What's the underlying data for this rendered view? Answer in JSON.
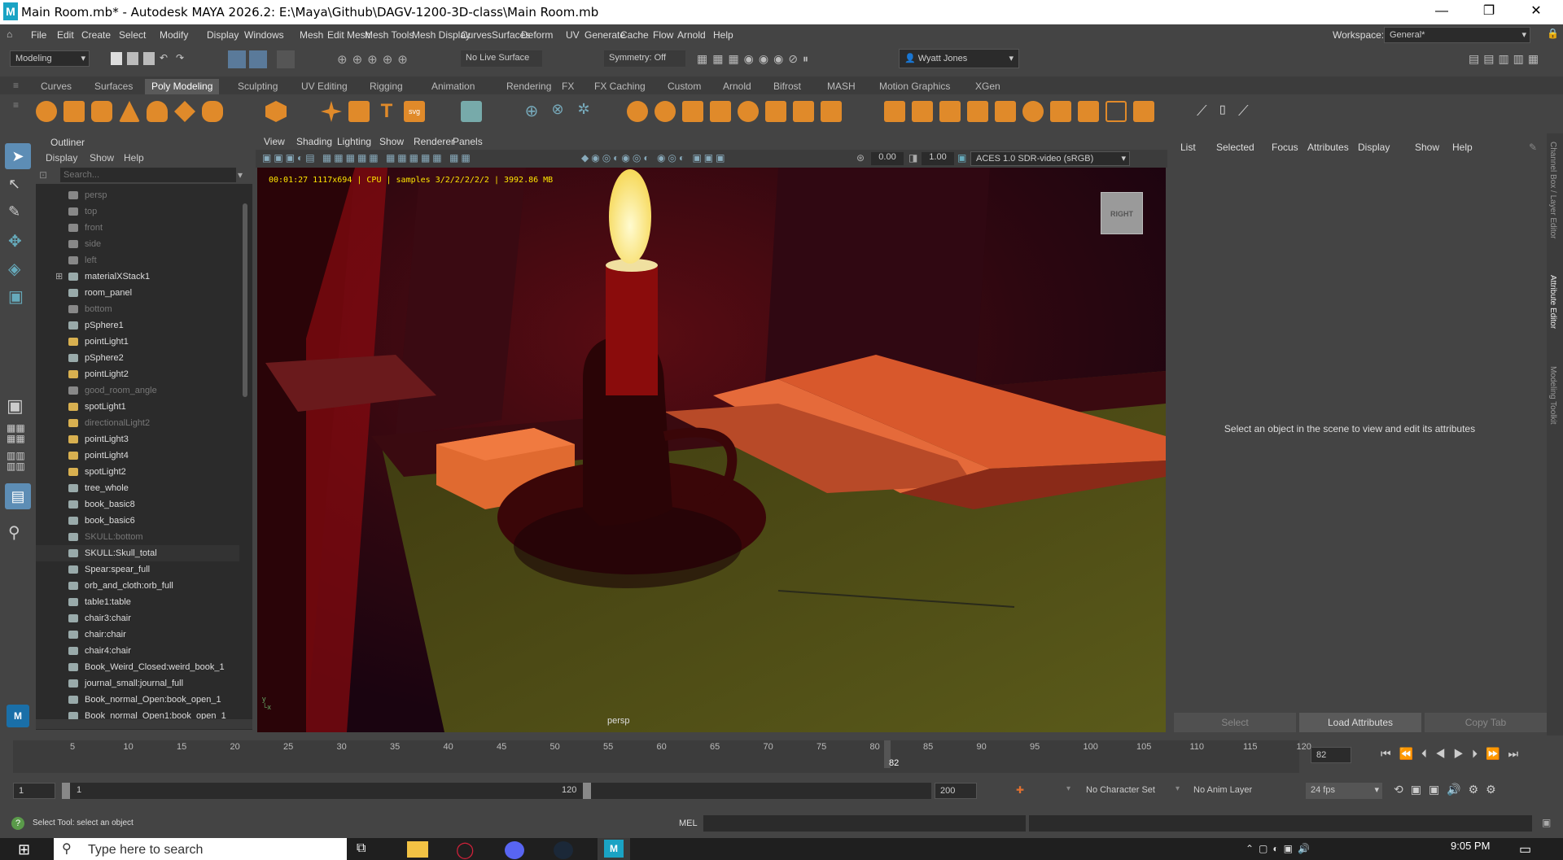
{
  "window": {
    "title": "Main Room.mb* - Autodesk MAYA 2026.2: E:\\Maya\\Github\\DAGV-1200-3D-class\\Main Room.mb",
    "app_icon": "M"
  },
  "menubar": {
    "items": [
      "File",
      "Edit",
      "Create",
      "Select",
      "Modify",
      "Display",
      "Windows",
      "Mesh",
      "Edit Mesh",
      "Mesh Tools",
      "Mesh Display",
      "Curves",
      "Surfaces",
      "Deform",
      "UV",
      "Generate",
      "Cache",
      "Flow",
      "Arnold",
      "Help"
    ],
    "workspace_label": "Workspace:",
    "workspace_value": "General*"
  },
  "toolbar": {
    "mode": "Modeling",
    "live_surface": "No Live Surface",
    "symmetry": "Symmetry: Off",
    "user": "Wyatt Jones"
  },
  "shelf_tabs": [
    "Curves",
    "Surfaces",
    "Poly Modeling",
    "Sculpting",
    "UV Editing",
    "Rigging",
    "Animation",
    "Rendering",
    "FX",
    "FX Caching",
    "Custom",
    "Arnold",
    "Bifrost",
    "MASH",
    "Motion Graphics",
    "XGen"
  ],
  "active_shelf": "Poly Modeling",
  "outliner": {
    "title": "Outliner",
    "menu": [
      "Display",
      "Show",
      "Help"
    ],
    "search_placeholder": "Search...",
    "items": [
      {
        "label": "persp",
        "dim": true,
        "kind": "camera"
      },
      {
        "label": "top",
        "dim": true,
        "kind": "camera"
      },
      {
        "label": "front",
        "dim": true,
        "kind": "camera"
      },
      {
        "label": "side",
        "dim": true,
        "kind": "camera"
      },
      {
        "label": "left",
        "dim": true,
        "kind": "camera"
      },
      {
        "label": "materialXStack1",
        "dim": false,
        "kind": "stack"
      },
      {
        "label": "room_panel",
        "dim": false,
        "kind": "mesh"
      },
      {
        "label": "bottom",
        "dim": true,
        "kind": "camera"
      },
      {
        "label": "pSphere1",
        "dim": false,
        "kind": "mesh"
      },
      {
        "label": "pointLight1",
        "dim": false,
        "kind": "light"
      },
      {
        "label": "pSphere2",
        "dim": false,
        "kind": "mesh"
      },
      {
        "label": "pointLight2",
        "dim": false,
        "kind": "light"
      },
      {
        "label": "good_room_angle",
        "dim": true,
        "kind": "camera"
      },
      {
        "label": "spotLight1",
        "dim": false,
        "kind": "light"
      },
      {
        "label": "directionalLight2",
        "dim": true,
        "kind": "light"
      },
      {
        "label": "pointLight3",
        "dim": false,
        "kind": "light"
      },
      {
        "label": "pointLight4",
        "dim": false,
        "kind": "light"
      },
      {
        "label": "spotLight2",
        "dim": false,
        "kind": "light"
      },
      {
        "label": "tree_whole",
        "dim": false,
        "kind": "mesh"
      },
      {
        "label": "book_basic8",
        "dim": false,
        "kind": "mesh"
      },
      {
        "label": "book_basic6",
        "dim": false,
        "kind": "mesh"
      },
      {
        "label": "SKULL:bottom",
        "dim": true,
        "kind": "mesh"
      },
      {
        "label": "SKULL:Skull_total",
        "dim": false,
        "kind": "mesh"
      },
      {
        "label": "Spear:spear_full",
        "dim": false,
        "kind": "mesh"
      },
      {
        "label": "orb_and_cloth:orb_full",
        "dim": false,
        "kind": "mesh"
      },
      {
        "label": "table1:table",
        "dim": false,
        "kind": "mesh"
      },
      {
        "label": "chair3:chair",
        "dim": false,
        "kind": "mesh"
      },
      {
        "label": "chair:chair",
        "dim": false,
        "kind": "mesh"
      },
      {
        "label": "chair4:chair",
        "dim": false,
        "kind": "mesh"
      },
      {
        "label": "Book_Weird_Closed:weird_book_1",
        "dim": false,
        "kind": "mesh"
      },
      {
        "label": "journal_small:journal_full",
        "dim": false,
        "kind": "mesh"
      },
      {
        "label": "Book_normal_Open:book_open_1",
        "dim": false,
        "kind": "mesh"
      },
      {
        "label": "Book_normal_Open1:book_open_1",
        "dim": false,
        "kind": "mesh"
      }
    ]
  },
  "viewport": {
    "menu": [
      "View",
      "Shading",
      "Lighting",
      "Show",
      "Renderer",
      "Panels"
    ],
    "exposure": "0.00",
    "gamma": "1.00",
    "color_space": "ACES 1.0 SDR-video (sRGB)",
    "hud": "00:01:27 1117x694 | CPU | samples 3/2/2/2/2/2 | 3992.86 MB",
    "camera_label": "persp",
    "viewcube": "RIGHT"
  },
  "attribute_editor": {
    "menu": [
      "List",
      "Selected",
      "Focus",
      "Attributes",
      "Display",
      "Show",
      "Help"
    ],
    "message": "Select an object in the scene to view and edit its attributes",
    "buttons": [
      "Select",
      "Load Attributes",
      "Copy Tab"
    ],
    "side_tabs": [
      "Channel Box / Layer Editor",
      "Attribute Editor",
      "Modeling Toolkit"
    ]
  },
  "timeline": {
    "ticks": [
      "5",
      "10",
      "15",
      "20",
      "25",
      "30",
      "35",
      "40",
      "45",
      "50",
      "55",
      "60",
      "65",
      "70",
      "75",
      "80",
      "85",
      "90",
      "95",
      "100",
      "105",
      "110",
      "115",
      "120"
    ],
    "current_frame": "82",
    "current_frame_field": "82"
  },
  "range": {
    "start": "1",
    "inner_start": "1",
    "inner_end": "120",
    "end": "200",
    "char_set": "No Character Set",
    "anim_layer": "No Anim Layer",
    "fps": "24 fps"
  },
  "status": {
    "help": "Select Tool: select an object",
    "cmd_lang": "MEL"
  },
  "taskbar": {
    "search_placeholder": "Type here to search",
    "time": "9:05 PM"
  }
}
